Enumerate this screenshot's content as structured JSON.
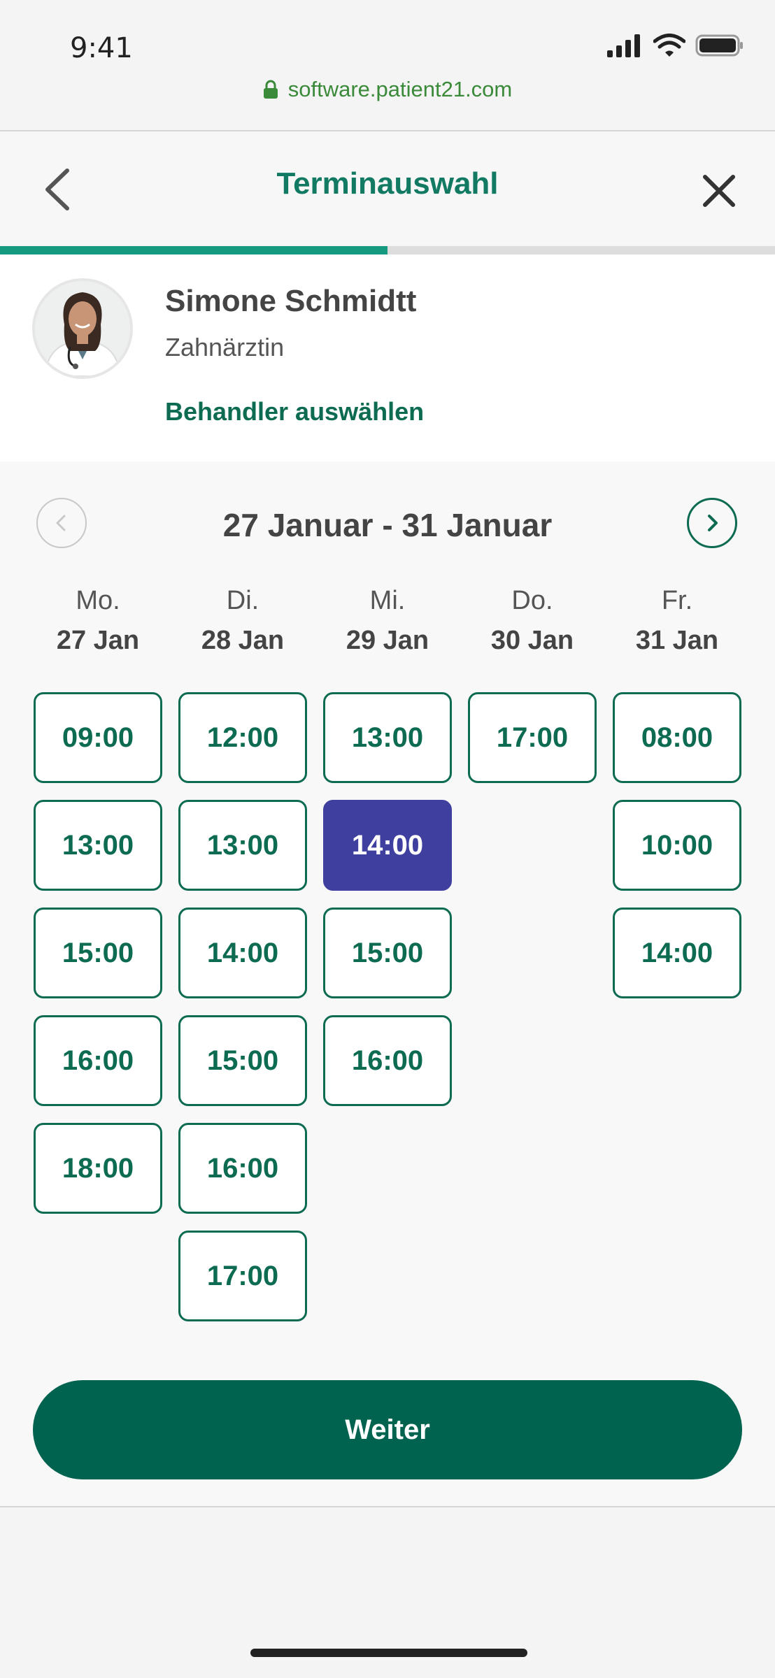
{
  "status_bar": {
    "time": "9:41"
  },
  "browser": {
    "url": "software.patient21.com"
  },
  "nav": {
    "title": "Terminauswahl",
    "progress": 0.5
  },
  "doctor": {
    "name": "Simone Schmidtt",
    "role": "Zahnärztin",
    "change_link": "Behandler auswählen"
  },
  "week": {
    "label": "27 Januar - 31 Januar"
  },
  "days": [
    {
      "day": "Mo.",
      "date": "27 Jan",
      "slots": [
        "09:00",
        "13:00",
        "15:00",
        "16:00",
        "18:00"
      ]
    },
    {
      "day": "Di.",
      "date": "28 Jan",
      "slots": [
        "12:00",
        "13:00",
        "14:00",
        "15:00",
        "16:00",
        "17:00"
      ]
    },
    {
      "day": "Mi.",
      "date": "29 Jan",
      "slots": [
        "13:00",
        "14:00",
        "15:00",
        "16:00"
      ]
    },
    {
      "day": "Do.",
      "date": "30 Jan",
      "slots": [
        "17:00"
      ]
    },
    {
      "day": "Fr.",
      "date": "31 Jan",
      "slots": [
        "08:00",
        "10:00",
        "14:00"
      ]
    }
  ],
  "selected_slot": {
    "date": "29 Jan",
    "time": "14:00"
  },
  "colors": {
    "brand": "#00634f",
    "accent": "#159a80",
    "selected": "#3f3f9f",
    "url": "#3a8a3a"
  },
  "footer": {
    "continue_label": "Weiter"
  }
}
